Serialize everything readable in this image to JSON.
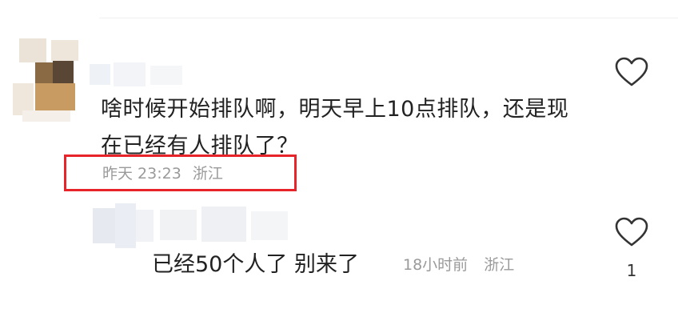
{
  "comment": {
    "text": "啥时候开始排队啊，明天早上10点排队，还是现在已经有人排队了？",
    "time": "昨天 23:23",
    "location": "浙江",
    "like_icon": "heart-outline-icon"
  },
  "reply": {
    "text": "已经50个人了 别来了",
    "time": "18小时前",
    "location": "浙江",
    "like_icon": "heart-outline-icon",
    "like_count": "1"
  },
  "colors": {
    "highlight": "#e8242b",
    "meta_text": "#9a9a9a",
    "body_text": "#222222"
  }
}
